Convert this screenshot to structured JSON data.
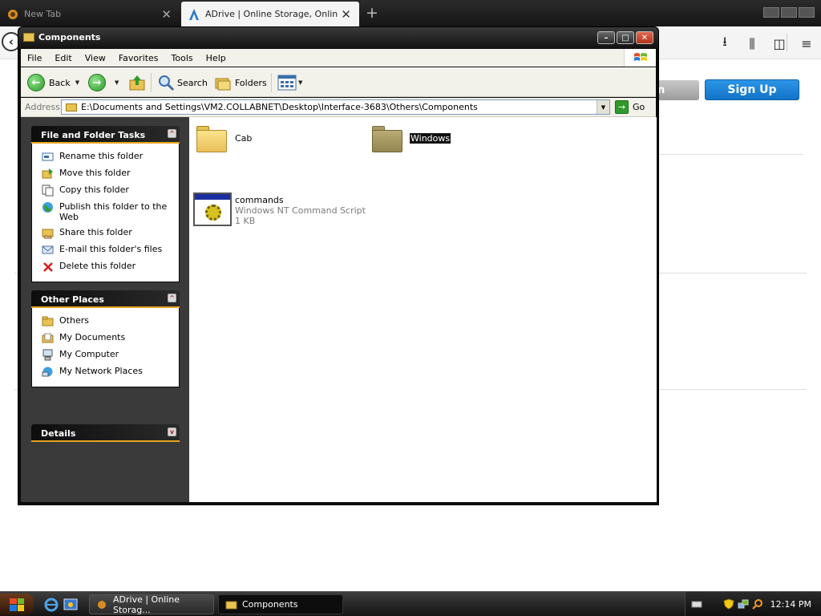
{
  "browser": {
    "tabs": [
      {
        "title": "New Tab",
        "active": false
      },
      {
        "title": "ADrive | Online Storage, Online Ba",
        "active": true
      }
    ],
    "new_tab_glyph": "+",
    "site": {
      "login_partial": "n",
      "signup_label": "Sign Up"
    }
  },
  "explorer": {
    "title": "Components",
    "menu": [
      "File",
      "Edit",
      "View",
      "Favorites",
      "Tools",
      "Help"
    ],
    "toolbar": {
      "back": "Back",
      "search": "Search",
      "folders": "Folders"
    },
    "address": {
      "label": "Address",
      "path": "E:\\Documents and Settings\\VM2.COLLABNET\\Desktop\\Interface-3683\\Others\\Components",
      "go": "Go"
    },
    "left_panels": {
      "tasks": {
        "title": "File and Folder Tasks",
        "items": [
          "Rename this folder",
          "Move this folder",
          "Copy this folder",
          "Publish this folder to the Web",
          "Share this folder",
          "E-mail this folder's files",
          "Delete this folder"
        ]
      },
      "other_places": {
        "title": "Other Places",
        "items": [
          "Others",
          "My Documents",
          "My Computer",
          "My Network Places"
        ]
      },
      "details": {
        "title": "Details"
      }
    },
    "files": {
      "cab": "Cab",
      "windows": "Windows",
      "commands": {
        "name": "commands",
        "type": "Windows NT Command Script",
        "size": "1 KB"
      }
    }
  },
  "taskbar": {
    "tasks": [
      {
        "label": "ADrive | Online Storag...",
        "active": false
      },
      {
        "label": "Components",
        "active": true
      }
    ],
    "clock": "12:14 PM"
  },
  "colors": {
    "accent_orange": "#e6a41e",
    "signup_blue": "#1a7fd4",
    "panel_dark": "#3a3a3a"
  }
}
